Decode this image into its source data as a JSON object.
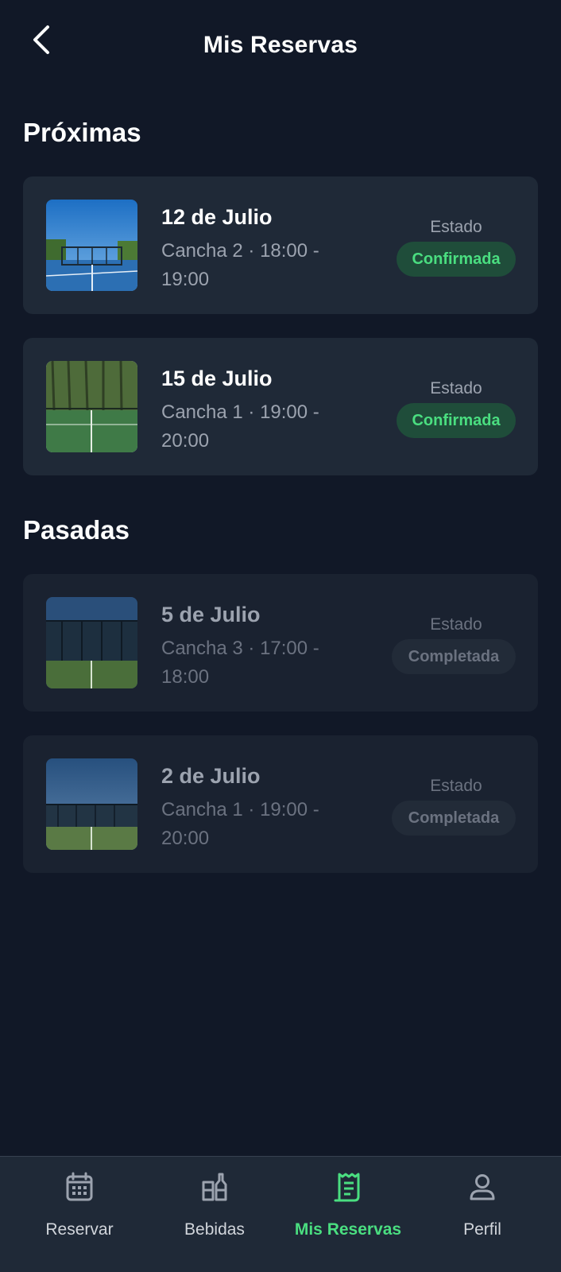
{
  "header": {
    "title": "Mis Reservas"
  },
  "sections": {
    "upcoming_title": "Próximas",
    "past_title": "Pasadas"
  },
  "upcoming": [
    {
      "date": "12 de Julio",
      "detail": "Cancha 2 · 18:00 - 19:00",
      "status_label": "Estado",
      "status": "Confirmada"
    },
    {
      "date": "15 de Julio",
      "detail": "Cancha 1 · 19:00 - 20:00",
      "status_label": "Estado",
      "status": "Confirmada"
    }
  ],
  "past": [
    {
      "date": "5 de Julio",
      "detail": "Cancha 3 · 17:00 - 18:00",
      "status_label": "Estado",
      "status": "Completada"
    },
    {
      "date": "2 de Julio",
      "detail": "Cancha 1 · 19:00 - 20:00",
      "status_label": "Estado",
      "status": "Completada"
    }
  ],
  "nav": {
    "items": [
      {
        "label": "Reservar",
        "icon": "calendar-icon"
      },
      {
        "label": "Bebidas",
        "icon": "drinks-icon"
      },
      {
        "label": "Mis Reservas",
        "icon": "receipt-icon",
        "active": true
      },
      {
        "label": "Perfil",
        "icon": "person-icon"
      }
    ]
  },
  "colors": {
    "background": "#111827",
    "card": "#1f2937",
    "accent": "#4ade80",
    "confirmed_badge": "#1f4d3a"
  }
}
